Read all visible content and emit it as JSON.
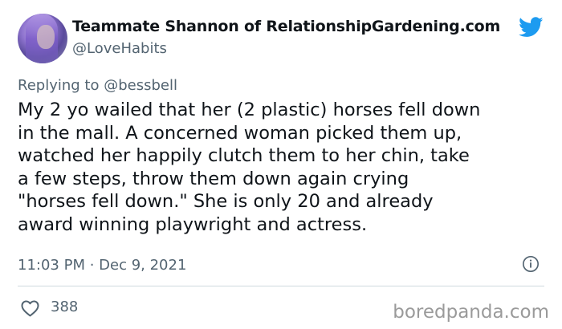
{
  "tweet": {
    "author_name": "Teammate Shannon of RelationshipGardening.com",
    "author_handle": "@LoveHabits",
    "replying_prefix": "Replying to",
    "replying_handle": "@bessbell",
    "body_lines": [
      "My 2 yo wailed that her (2 plastic) horses fell down",
      "in the mall. A concerned woman picked them up,",
      "watched her happily clutch them to her chin, take",
      "a few steps, throw them down again crying",
      "\"horses fell down.\" She is only 20 and already",
      "award winning playwright and actress."
    ],
    "timestamp": "11:03 PM · Dec 9, 2021",
    "like_count": "388"
  },
  "icons": {
    "brand": "twitter-bird-icon",
    "info": "info-icon",
    "like": "heart-icon"
  },
  "watermark": "boredpanda.com",
  "colors": {
    "twitter_blue": "#1d9bf0",
    "text_primary": "#0f1419",
    "text_secondary": "#536471",
    "divider": "#cfd9de",
    "watermark": "#9a9a9a"
  }
}
